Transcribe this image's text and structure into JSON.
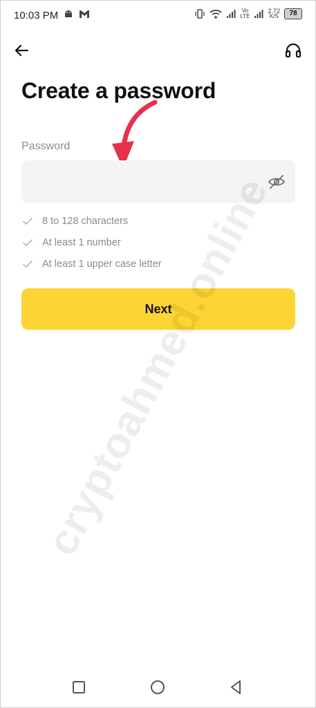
{
  "status_bar": {
    "time": "10:03 PM",
    "left_icons": [
      "android-icon",
      "gmail-icon"
    ],
    "right_icons": [
      "vibrate-icon",
      "wifi-icon",
      "signal-icon",
      "volte-icon",
      "signal-icon"
    ],
    "volte_label_top": "Vo",
    "volte_label_bottom": "LTE",
    "speed_value": "2.72",
    "speed_unit": "K/S",
    "battery": "78"
  },
  "header": {
    "back_icon": "arrow-left-icon",
    "support_icon": "headset-icon"
  },
  "main": {
    "title": "Create a password",
    "password_label": "Password",
    "password_value": "",
    "password_placeholder": "",
    "visibility_icon": "eye-off-icon",
    "requirements": [
      {
        "label": "8 to 128 characters",
        "met": false
      },
      {
        "label": "At least 1 number",
        "met": false
      },
      {
        "label": "At least 1 upper case letter",
        "met": false
      }
    ],
    "next_label": "Next"
  },
  "colors": {
    "accent": "#fcd535",
    "annotation_arrow": "#e8304f",
    "label_gray": "#8c8c8c",
    "field_bg": "#f4f4f4"
  },
  "watermark": "cryptoahmed.online",
  "nav_bar": {
    "recents_icon": "square-icon",
    "home_icon": "circle-icon",
    "back_icon": "triangle-back-icon"
  }
}
